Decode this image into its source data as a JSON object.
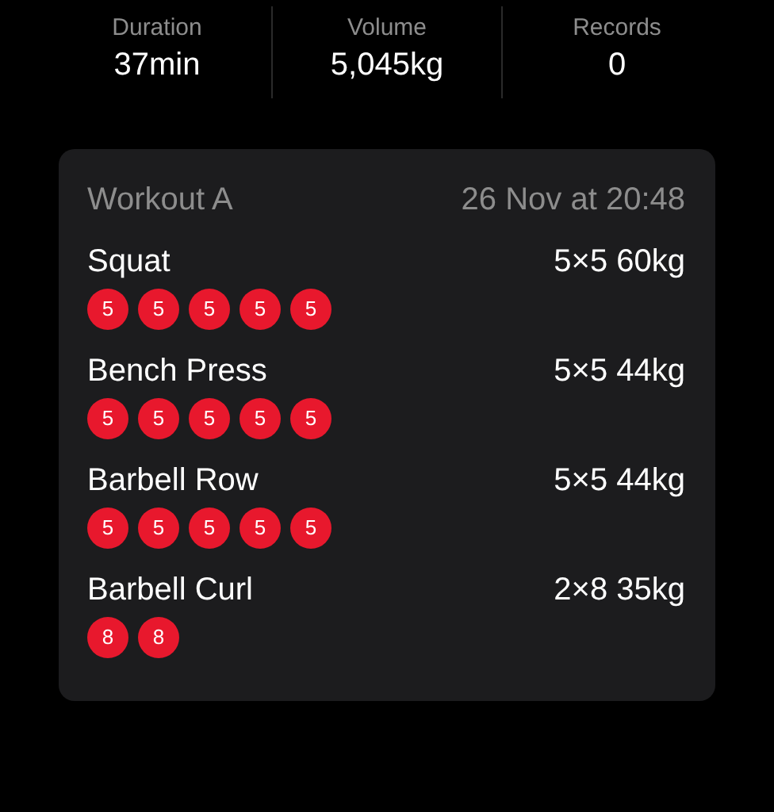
{
  "stats": [
    {
      "label": "Duration",
      "value": "37min"
    },
    {
      "label": "Volume",
      "value": "5,045kg"
    },
    {
      "label": "Records",
      "value": "0"
    }
  ],
  "workout": {
    "title": "Workout A",
    "date": "26 Nov at 20:48",
    "exercises": [
      {
        "name": "Squat",
        "summary": "5×5 60kg",
        "sets": [
          "5",
          "5",
          "5",
          "5",
          "5"
        ]
      },
      {
        "name": "Bench Press",
        "summary": "5×5 44kg",
        "sets": [
          "5",
          "5",
          "5",
          "5",
          "5"
        ]
      },
      {
        "name": "Barbell Row",
        "summary": "5×5 44kg",
        "sets": [
          "5",
          "5",
          "5",
          "5",
          "5"
        ]
      },
      {
        "name": "Barbell Curl",
        "summary": "2×8 35kg",
        "sets": [
          "8",
          "8"
        ]
      }
    ]
  }
}
